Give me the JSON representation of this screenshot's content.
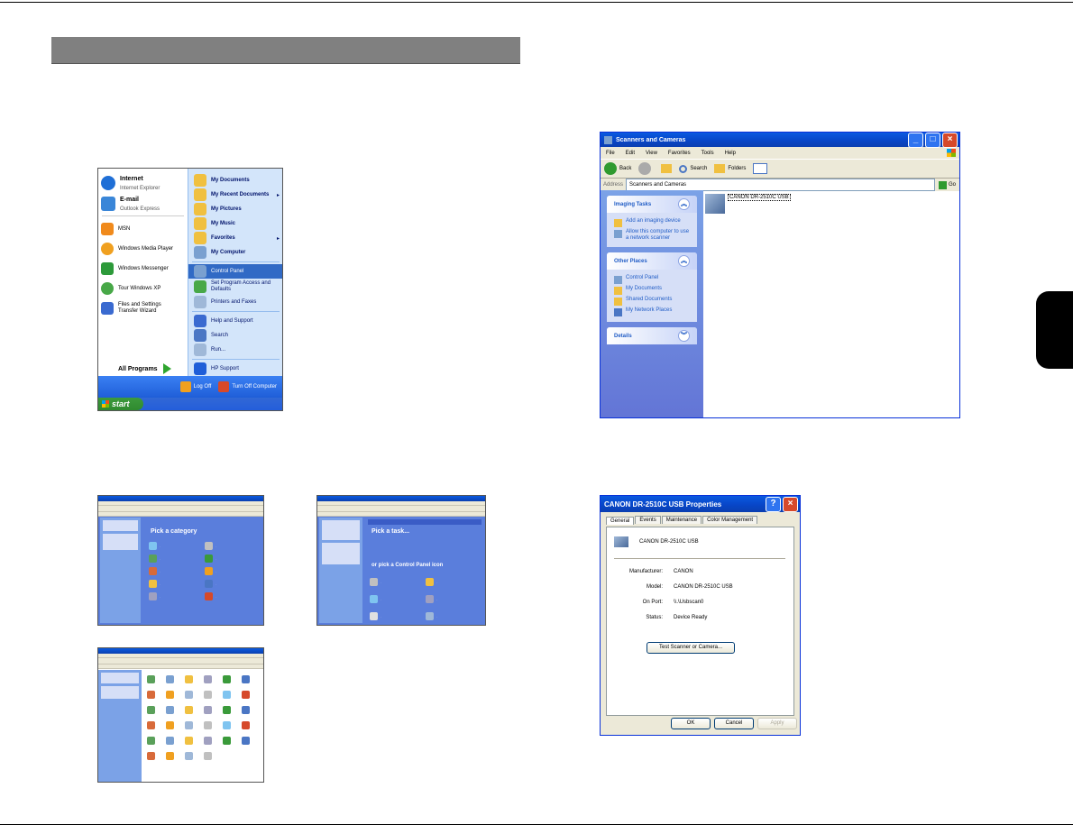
{
  "start_menu": {
    "pinned": [
      {
        "title": "Internet",
        "sub": "Internet Explorer",
        "color": "#1f6fd6"
      },
      {
        "title": "E-mail",
        "sub": "Outlook Express",
        "color": "#3a86d8"
      }
    ],
    "recent": [
      {
        "label": "MSN",
        "color": "#f08a1c"
      },
      {
        "label": "Windows Media Player",
        "color": "#f0a020"
      },
      {
        "label": "Windows Messenger",
        "color": "#2d9a3a"
      },
      {
        "label": "Tour Windows XP",
        "color": "#48a848"
      },
      {
        "label": "Files and Settings Transfer Wizard",
        "color": "#3a6ad0"
      }
    ],
    "all_programs": "All Programs",
    "right_items": [
      {
        "label": "My Documents",
        "bold": true
      },
      {
        "label": "My Recent Documents",
        "bold": true,
        "arrow": true
      },
      {
        "label": "My Pictures",
        "bold": true
      },
      {
        "label": "My Music",
        "bold": true
      },
      {
        "label": "Favorites",
        "bold": true,
        "arrow": true
      },
      {
        "label": "My Computer",
        "bold": true
      },
      {
        "label": "Control Panel",
        "highlight": true
      },
      {
        "label": "Set Program Access and Defaults"
      },
      {
        "label": "Printers and Faxes"
      },
      {
        "label": "Help and Support"
      },
      {
        "label": "Search"
      },
      {
        "label": "Run..."
      },
      {
        "label": "HP Support"
      }
    ],
    "log_off": "Log Off",
    "turn_off": "Turn Off Computer",
    "start": "start"
  },
  "scanners_window": {
    "title": "Scanners and Cameras",
    "menu": [
      "File",
      "Edit",
      "View",
      "Favorites",
      "Tools",
      "Help"
    ],
    "toolbar": {
      "back": "Back",
      "search": "Search",
      "folders": "Folders"
    },
    "address_label": "Address",
    "address_value": "Scanners and Cameras",
    "go": "Go",
    "imaging_tasks": {
      "header": "Imaging Tasks",
      "items": [
        "Add an imaging device",
        "Allow this computer to use a network scanner"
      ]
    },
    "other_places": {
      "header": "Other Places",
      "items": [
        "Control Panel",
        "My Documents",
        "Shared Documents",
        "My Network Places"
      ]
    },
    "details": {
      "header": "Details"
    },
    "device": "CANON DR-2510C USB"
  },
  "properties_dialog": {
    "title": "CANON DR-2510C USB Properties",
    "tabs": [
      "General",
      "Events",
      "Maintenance",
      "Color Management"
    ],
    "device_name": "CANON DR-2510C USB",
    "fields": [
      {
        "label": "Manufacturer:",
        "value": "CANON"
      },
      {
        "label": "Model:",
        "value": "CANON DR-2510C USB"
      },
      {
        "label": "On Port:",
        "value": "\\\\.\\Usbscan0"
      },
      {
        "label": "Status:",
        "value": "Device Ready"
      }
    ],
    "test_button": "Test Scanner or Camera...",
    "ok": "OK",
    "cancel": "Cancel",
    "apply": "Apply"
  },
  "thumbnails": {
    "category_view": {
      "heading": "Pick a category"
    },
    "printers_view": {
      "heading1": "Pick a task...",
      "heading2": "or pick a Control Panel icon"
    }
  }
}
